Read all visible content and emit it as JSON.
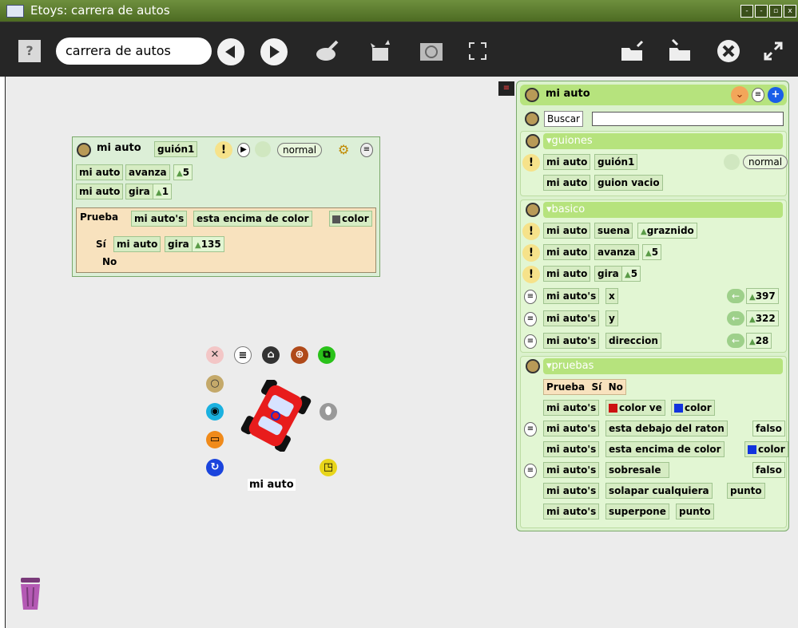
{
  "window": {
    "title": "Etoys: carrera de autos",
    "buttons": [
      "-",
      "-",
      "▫",
      "x"
    ]
  },
  "toolbar": {
    "help_label": "?",
    "project_name": "carrera de autos",
    "icons": [
      "back-arrow",
      "forward-arrow",
      "paint-brush",
      "object-catalog",
      "world-icon",
      "fullscreen",
      "load-project",
      "save-project",
      "close",
      "expand"
    ]
  },
  "script": {
    "player": "mi auto",
    "name": "guión1",
    "mode": "normal",
    "rows": [
      {
        "player": "mi auto",
        "cmd": "avanza",
        "val": "5"
      },
      {
        "player": "mi auto",
        "cmd": "gira",
        "val": "1"
      }
    ],
    "test": {
      "label": "Prueba",
      "subject": "mi auto's",
      "condition": "esta encima de color",
      "color_label": "color",
      "yes_label": "Sí",
      "yes_player": "mi auto",
      "yes_cmd": "gira",
      "yes_val": "135",
      "no_label": "No"
    }
  },
  "car": {
    "label": "mi auto"
  },
  "viewer": {
    "title": "mi auto",
    "search_label": "Buscar",
    "search_value": "",
    "sections": {
      "guiones": {
        "title": "guiones",
        "rows": [
          {
            "player": "mi auto",
            "cmd": "guión1",
            "mode": "normal"
          },
          {
            "player": "mi auto",
            "cmd": "guion vacio"
          }
        ]
      },
      "basico": {
        "title": "basico",
        "rows": [
          {
            "player": "mi auto",
            "cmd": "suena",
            "val": "graznido"
          },
          {
            "player": "mi auto",
            "cmd": "avanza",
            "val": "5"
          },
          {
            "player": "mi auto",
            "cmd": "gira",
            "val": "5"
          }
        ],
        "vars": [
          {
            "player": "mi auto's",
            "name": "x",
            "val": "397"
          },
          {
            "player": "mi auto's",
            "name": "y",
            "val": "322"
          },
          {
            "player": "mi auto's",
            "name": "direccion",
            "val": "28"
          }
        ]
      },
      "pruebas": {
        "title": "pruebas",
        "prueba": "Prueba",
        "si": "Sí",
        "no": "No",
        "rows": [
          {
            "player": "mi auto's",
            "pre_color": "#cc1111",
            "text": "color ve",
            "post_color": "#1133dd",
            "post": "color"
          },
          {
            "player": "mi auto's",
            "text": "esta debajo del raton",
            "val": "falso"
          },
          {
            "player": "mi auto's",
            "text": "esta encima de color",
            "post_color": "#1133dd",
            "post": "color"
          },
          {
            "player": "mi auto's",
            "text": "sobresale",
            "val": "falso"
          },
          {
            "player": "mi auto's",
            "text": "solapar cualquiera",
            "post": "punto"
          },
          {
            "player": "mi auto's",
            "text": "superpone",
            "post": "punto"
          }
        ]
      }
    }
  },
  "colors": {
    "tile_green": "#d6ecc3",
    "header_green": "#b6e37d",
    "test_beige": "#f8e2be",
    "toolbar": "#262626"
  }
}
